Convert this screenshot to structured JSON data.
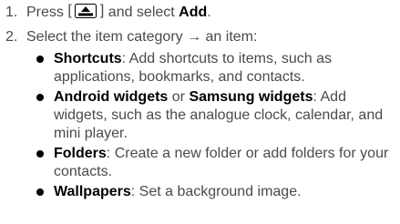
{
  "steps": [
    {
      "number": "1.",
      "before": "Press ",
      "bracket_open": "[",
      "bracket_close": "]",
      "icon": "menu-key-icon",
      "middle": " and select ",
      "bold": "Add",
      "after": "."
    },
    {
      "number": "2.",
      "text": "Select the item category → an item:"
    }
  ],
  "bullets": [
    {
      "term": "Shortcuts",
      "desc": ": Add shortcuts to items, such as applications, bookmarks, and contacts."
    },
    {
      "term": "Android widgets",
      "join": " or ",
      "term2": "Samsung widgets",
      "desc": ": Add widgets, such as the analogue clock, calendar, and mini player."
    },
    {
      "term": "Folders",
      "desc": ": Create a new folder or add folders for your contacts."
    },
    {
      "term": "Wallpapers",
      "desc": ": Set a background image."
    }
  ],
  "colors": {
    "text": "#4a4a4a",
    "bold": "#000000"
  }
}
